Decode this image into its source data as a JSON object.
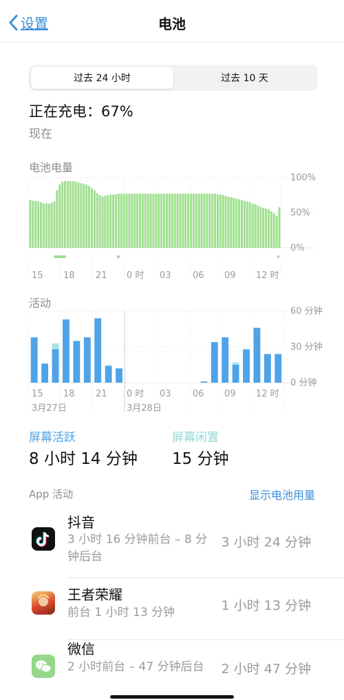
{
  "nav": {
    "back_label": "设置",
    "title": "电池"
  },
  "segments": [
    {
      "label": "过去 24 小时",
      "active": true
    },
    {
      "label": "过去 10 天",
      "active": false
    }
  ],
  "charging": {
    "status": "正在充电：67%",
    "time": "现在"
  },
  "battery_chart": {
    "title": "电池电量",
    "y_ticks": [
      "100%",
      "50%",
      "0%"
    ],
    "x_ticks": [
      "15",
      "18",
      "21",
      "0 时",
      "03",
      "06",
      "09",
      "12 时"
    ],
    "color": "#9fdf8f"
  },
  "activity_chart": {
    "title": "活动",
    "y_ticks": [
      "60 分钟",
      "30 分钟",
      "0 分钟"
    ],
    "x_ticks": [
      "15",
      "18",
      "21",
      "0 时",
      "03",
      "06",
      "09",
      "12 时"
    ],
    "dates": [
      "3月27日",
      "3月28日"
    ],
    "color_active": "#4fa3e8",
    "color_idle": "#a6e6e3"
  },
  "chart_data": [
    {
      "type": "bar",
      "title": "电池电量",
      "ylim": [
        0,
        100
      ],
      "yticks": [
        "100%",
        "50%",
        "0%"
      ],
      "xticks": [
        "15",
        "18",
        "21",
        "0 时",
        "03",
        "06",
        "09",
        "12 时"
      ],
      "values": [
        68,
        67,
        67,
        66,
        65,
        63,
        63,
        63,
        64,
        66,
        82,
        90,
        94,
        95,
        95,
        95,
        95,
        94,
        93,
        92,
        91,
        90,
        88,
        85,
        82,
        78,
        75,
        73,
        74,
        75,
        76,
        76,
        76,
        77,
        77,
        77,
        77,
        77,
        77,
        77,
        77,
        77,
        77,
        77,
        77,
        77,
        77,
        77,
        77,
        77,
        77,
        77,
        77,
        77,
        77,
        77,
        77,
        77,
        77,
        77,
        77,
        77,
        77,
        77,
        77,
        77,
        77,
        77,
        77,
        77,
        76,
        76,
        75,
        74,
        73,
        72,
        71,
        70,
        69,
        68,
        67,
        66,
        65,
        63,
        62,
        60,
        58,
        57,
        56,
        55,
        52,
        49,
        45,
        58
      ]
    },
    {
      "type": "bar",
      "title": "活动",
      "ylim": [
        0,
        60
      ],
      "yticks": [
        "60 分钟",
        "30 分钟",
        "0 分钟"
      ],
      "xticks": [
        "15",
        "18",
        "21",
        "0 时",
        "03",
        "06",
        "09",
        "12 时"
      ],
      "categories": [
        "15",
        "16",
        "17",
        "18",
        "19",
        "20",
        "21",
        "22",
        "23",
        "0",
        "1",
        "2",
        "3",
        "4",
        "5",
        "6",
        "7",
        "8",
        "9",
        "10",
        "11",
        "12",
        "13",
        "14"
      ],
      "series": [
        {
          "name": "屏幕活跃",
          "values": [
            38,
            16,
            28,
            53,
            35,
            38,
            54,
            14,
            12,
            0,
            0,
            0,
            0,
            0,
            0,
            0,
            1,
            34,
            38,
            15,
            28,
            46,
            24,
            24
          ]
        },
        {
          "name": "屏幕闲置",
          "values": [
            0,
            0,
            5,
            0,
            0,
            0,
            0,
            1,
            0,
            0,
            0,
            0,
            0,
            0,
            0,
            0,
            0,
            0,
            0,
            2,
            0,
            0,
            0,
            0
          ]
        }
      ]
    }
  ],
  "stats": {
    "active": {
      "label": "屏幕活跃",
      "value": "8 小时 14 分钟",
      "color": "#4fa3e8"
    },
    "idle": {
      "label": "屏幕闲置",
      "value": "15 分钟",
      "color": "#8fd8d6"
    }
  },
  "app_activity": {
    "label": "App 活动",
    "show_usage": "显示电池用量",
    "apps": [
      {
        "name": "抖音",
        "detail": "3 小时 16 分钟前台 – 8 分钟后台",
        "total": "3 小时 24 分钟",
        "icon": "douyin-icon"
      },
      {
        "name": "王者荣耀",
        "detail": "前台 1 小时 13 分钟",
        "total": "1 小时 13 分钟",
        "icon": "honor-of-kings-icon"
      },
      {
        "name": "微信",
        "detail": "2 小时前台 – 47 分钟后台",
        "total": "2 小时 47 分钟",
        "icon": "wechat-icon"
      }
    ]
  }
}
